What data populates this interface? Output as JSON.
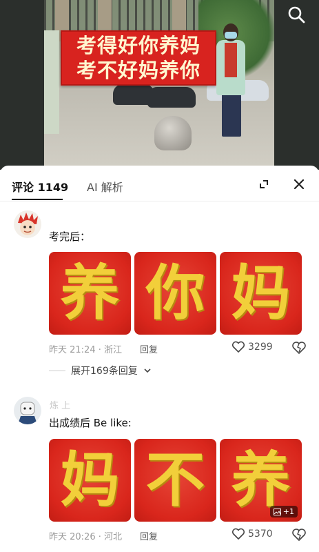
{
  "video": {
    "banner_line1": "考得好你养妈",
    "banner_line2": "考不好妈养你",
    "search_icon": "search-icon"
  },
  "comments_panel": {
    "tabs": [
      {
        "label": "评论 1149"
      },
      {
        "label": "AI 解析"
      }
    ],
    "actions": {
      "expand_icon": "expand-icon",
      "close_icon": "close-icon"
    }
  },
  "comments": [
    {
      "text": "考完后：",
      "images": [
        "养",
        "你",
        "妈"
      ],
      "meta": "昨天 21:24 · 浙江",
      "reply_label": "回复",
      "likes": "3299",
      "expand_label": "展开169条回复"
    },
    {
      "username": "炼 上",
      "text": "出成绩后 Be like:",
      "images": [
        "妈",
        "不",
        "养"
      ],
      "more_images": "+1",
      "meta": "昨天 20:26 · 河北",
      "reply_label": "回复",
      "likes": "5370"
    }
  ],
  "colors": {
    "meme_red": "#d9261c",
    "meme_gold": "#f2cf3a",
    "banner_red": "#d8231f"
  }
}
